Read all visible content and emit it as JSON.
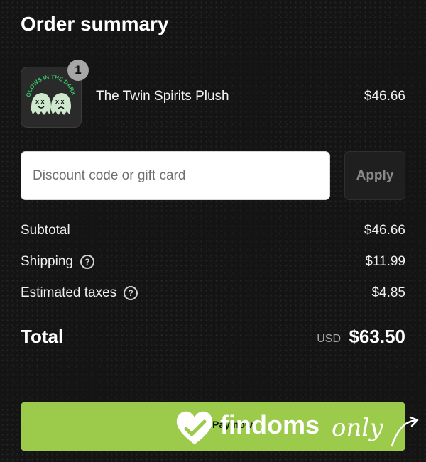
{
  "header": {
    "title": "Order summary"
  },
  "product": {
    "name": "The Twin Spirits Plush",
    "price": "$46.66",
    "quantity": "1",
    "image_text": "GLOWS IN THE DARK"
  },
  "discount": {
    "placeholder": "Discount code or gift card",
    "apply_label": "Apply"
  },
  "summary": {
    "subtotal_label": "Subtotal",
    "subtotal_value": "$46.66",
    "shipping_label": "Shipping",
    "shipping_value": "$11.99",
    "taxes_label": "Estimated taxes",
    "taxes_value": "$4.85",
    "help_icon": "?"
  },
  "total": {
    "label": "Total",
    "currency": "USD",
    "value": "$63.50"
  },
  "pay": {
    "label": "Pay now"
  },
  "watermark": {
    "brand": "findoms",
    "script": "only"
  },
  "colors": {
    "background": "#141414",
    "pay_button": "#9ccb4c",
    "thumbnail_ring": "#35c76b"
  },
  "icons": [
    "question-circle-icon",
    "heart-logo-icon",
    "arrow-icon"
  ]
}
